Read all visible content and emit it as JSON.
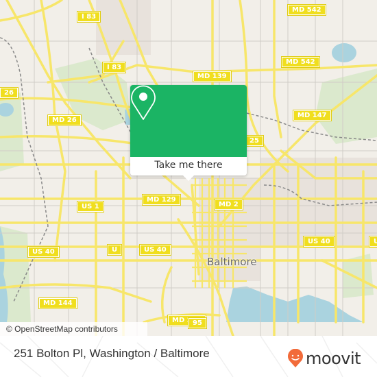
{
  "map": {
    "attribution": "© OpenStreetMap contributors",
    "city_label": "Baltimore",
    "road_shields": [
      {
        "label": "I 83"
      },
      {
        "label": "I 83"
      },
      {
        "label": "MD 542"
      },
      {
        "label": "MD 542"
      },
      {
        "label": "MD 139"
      },
      {
        "label": "26"
      },
      {
        "label": "MD 26"
      },
      {
        "label": "MD 147"
      },
      {
        "label": "25"
      },
      {
        "label": "US 1"
      },
      {
        "label": "MD 129"
      },
      {
        "label": "MD 2"
      },
      {
        "label": "US 40"
      },
      {
        "label": "U"
      },
      {
        "label": "US 40"
      },
      {
        "label": "US 40"
      },
      {
        "label": "U"
      },
      {
        "label": "MD 144"
      },
      {
        "label": "MD 295"
      },
      {
        "label": "95"
      }
    ]
  },
  "popup": {
    "icon": "location-pin-icon",
    "button_label": "Take me there"
  },
  "footer": {
    "address": "251 Bolton Pl, Washington / Baltimore",
    "brand": "moovit",
    "brand_color": "#f26b3a"
  },
  "colors": {
    "popup_green": "#1bb464",
    "road_yellow": "#f7e66a",
    "water": "#aad3df",
    "park": "#d8e8c8"
  }
}
